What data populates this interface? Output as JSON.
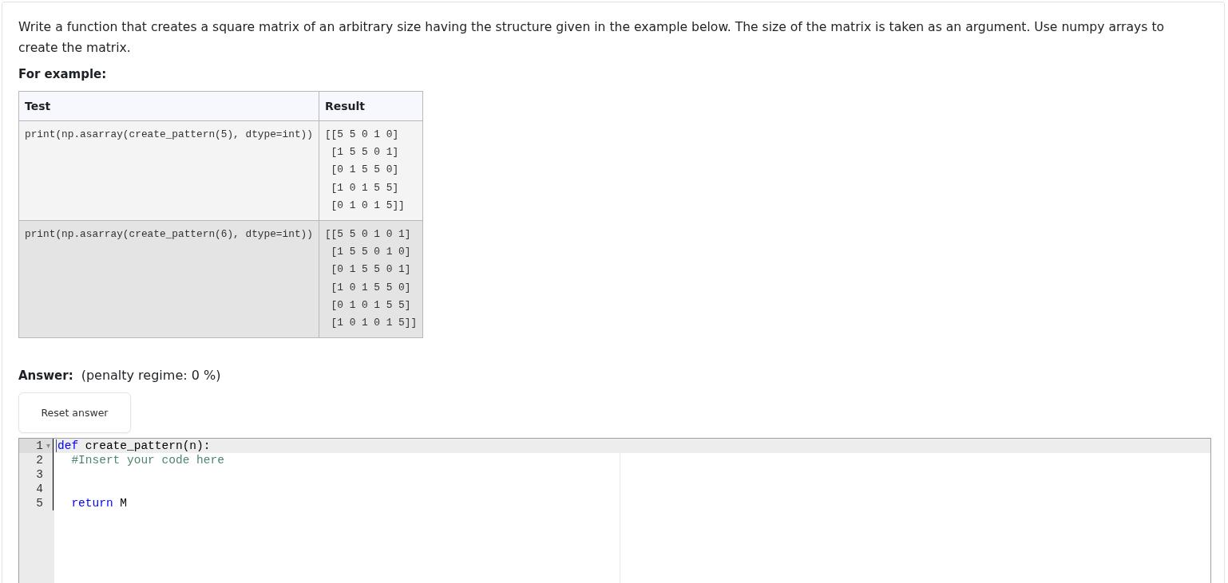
{
  "question": {
    "text": "Write a function that creates a square matrix of an arbitrary size having the structure given in the example below. The size of the matrix is taken as an argument. Use numpy arrays to create the matrix."
  },
  "example": {
    "heading": "For example:",
    "columns": [
      "Test",
      "Result"
    ],
    "rows": [
      {
        "test": "print(np.asarray(create_pattern(5), dtype=int))",
        "result": "[[5 5 0 1 0]\n [1 5 5 0 1]\n [0 1 5 5 0]\n [1 0 1 5 5]\n [0 1 0 1 5]]"
      },
      {
        "test": "print(np.asarray(create_pattern(6), dtype=int))",
        "result": "[[5 5 0 1 0 1]\n [1 5 5 0 1 0]\n [0 1 5 5 0 1]\n [1 0 1 5 5 0]\n [0 1 0 1 5 5]\n [1 0 1 0 1 5]]"
      }
    ]
  },
  "answer": {
    "label": "Answer:",
    "penalty": "(penalty regime: 0 %)",
    "reset_button": "Reset answer"
  },
  "code_editor": {
    "lines": [
      {
        "number": "1",
        "active": true,
        "foldable": true,
        "tokens": [
          {
            "kind": "keyword",
            "text": "def"
          },
          {
            "kind": "plain",
            "text": " create_pattern(n):"
          }
        ]
      },
      {
        "number": "2",
        "active": false,
        "foldable": false,
        "tokens": [
          {
            "kind": "comment",
            "text": "  #Insert your code here"
          }
        ]
      },
      {
        "number": "3",
        "active": false,
        "foldable": false
      },
      {
        "number": "4",
        "active": false,
        "foldable": false
      },
      {
        "number": "5",
        "active": false,
        "foldable": false,
        "tokens": [
          {
            "kind": "keyword",
            "text": "  return"
          },
          {
            "kind": "plain",
            "text": " M"
          }
        ]
      }
    ]
  }
}
